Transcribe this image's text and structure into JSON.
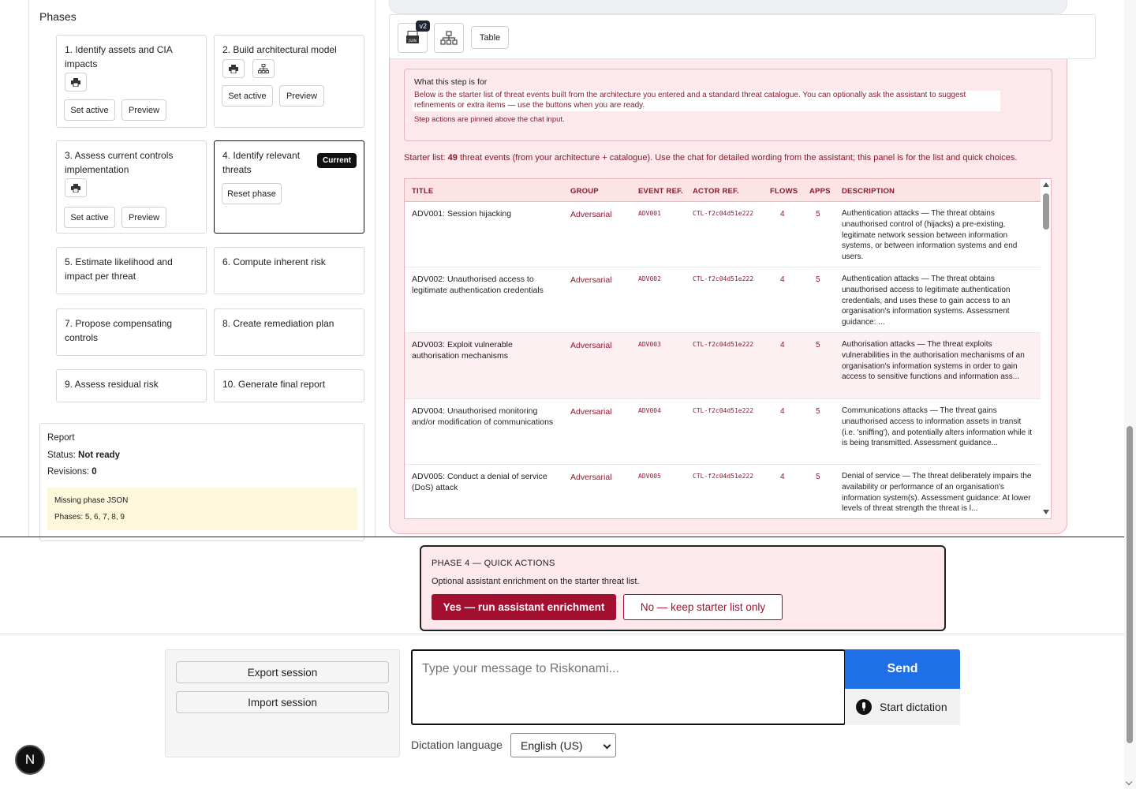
{
  "phases": {
    "heading": "Phases",
    "items": [
      {
        "title": "1. Identify assets and CIA impacts",
        "btn1": "Set active",
        "btn2": "Preview"
      },
      {
        "title": "2. Build architectural model",
        "btn1": "Set active",
        "btn2": "Preview"
      },
      {
        "title": "3. Assess current controls implementation",
        "btn1": "Set active",
        "btn2": "Preview"
      },
      {
        "title": "4. Identify relevant threats",
        "badge": "Current",
        "btn1": "Reset phase"
      },
      {
        "title": "5. Estimate likelihood and impact per threat"
      },
      {
        "title": "6. Compute inherent risk"
      },
      {
        "title": "7. Propose compensating controls"
      },
      {
        "title": "8. Create remediation plan"
      },
      {
        "title": "9. Assess residual risk"
      },
      {
        "title": "10. Generate final report"
      }
    ]
  },
  "report": {
    "title": "Report",
    "status_label": "Status:",
    "status_value": "Not ready",
    "revisions_label": "Revisions:",
    "revisions_value": "0",
    "missing_title": "Missing phase JSON",
    "missing_phases": "Phases: 5, 6, 7, 8, 9"
  },
  "toolbar": {
    "version_badge": "v2",
    "table_label": "Table"
  },
  "info_box": {
    "title": "What this step is for",
    "text": "Below is the starter list of threat events built from the architecture you entered and a standard threat catalogue. You can optionally ask the assistant to suggest refinements or extra items — use the buttons when you are ready.",
    "note": "Step actions are pinned above the chat input."
  },
  "starter": {
    "prefix": "Starter list:",
    "count": "49",
    "suffix": "threat events (from your architecture + catalogue). Use the chat for detailed wording from the assistant; this panel is for the list and quick choices."
  },
  "table": {
    "columns": [
      "TITLE",
      "GROUP",
      "EVENT REF.",
      "ACTOR REF.",
      "FLOWS",
      "APPS",
      "DESCRIPTION"
    ],
    "rows": [
      {
        "title": "ADV001: Session hijacking",
        "group": "Adversarial",
        "event": "ADV001",
        "actor": "CTL-f2c04d51e222",
        "flows": "4",
        "apps": "5",
        "desc": "Authentication attacks — The threat obtains unauthorised control of (hijacks) a pre-existing, legitimate network session between information systems, or between information systems and end users."
      },
      {
        "title": "ADV002: Unauthorised access to legitimate authentication credentials",
        "group": "Adversarial",
        "event": "ADV002",
        "actor": "CTL-f2c04d51e222",
        "flows": "4",
        "apps": "5",
        "desc": "Authentication attacks — The threat obtains unauthorised access to legitimate authentication credentials, and uses these to gain access to an organisation's information systems. Assessment guidance: ..."
      },
      {
        "title": "ADV003: Exploit vulnerable authorisation mechanisms",
        "group": "Adversarial",
        "event": "ADV003",
        "actor": "CTL-f2c04d51e222",
        "flows": "4",
        "apps": "5",
        "desc": "Authorisation attacks — The threat exploits vulnerabilities in the authorisation mechanisms of an organisation's information systems in order to gain access to sensitive functions and information ass..."
      },
      {
        "title": "ADV004: Unauthorised monitoring and/or modification of communications",
        "group": "Adversarial",
        "event": "ADV004",
        "actor": "CTL-f2c04d51e222",
        "flows": "4",
        "apps": "5",
        "desc": "Communications attacks — The threat gains unauthorised access to information assets in transit (i.e. 'sniffing'), and potentially alters information while it is being transmitted. Assessment guidance..."
      },
      {
        "title": "ADV005: Conduct a denial of service (DoS) attack",
        "group": "Adversarial",
        "event": "ADV005",
        "actor": "CTL-f2c04d51e222",
        "flows": "4",
        "apps": "5",
        "desc": "Denial of service — The threat deliberately impairs the availability or performance of an organisation's information system(s). Assessment guidance: At lower levels of threat strength the threat is l..."
      }
    ]
  },
  "quick_actions": {
    "title": "PHASE 4 — QUICK ACTIONS",
    "subtitle": "Optional assistant enrichment on the starter threat list.",
    "yes_label": "Yes — run assistant enrichment",
    "no_label": "No — keep starter list only"
  },
  "session": {
    "export_label": "Export session",
    "import_label": "Import session"
  },
  "chat": {
    "placeholder": "Type your message to Riskonami...",
    "send_label": "Send",
    "dictation_button": "Start dictation",
    "dictation_language_label": "Dictation language",
    "dictation_language_value": "English (US)"
  },
  "fab": {
    "label": "N"
  },
  "colors": {
    "accent": "#a3102f",
    "blue": "#1f6fe6",
    "pink_bg": "#fde8eb",
    "pink_border": "#e6b5bd",
    "yellow_bg": "#fdf8dc"
  }
}
